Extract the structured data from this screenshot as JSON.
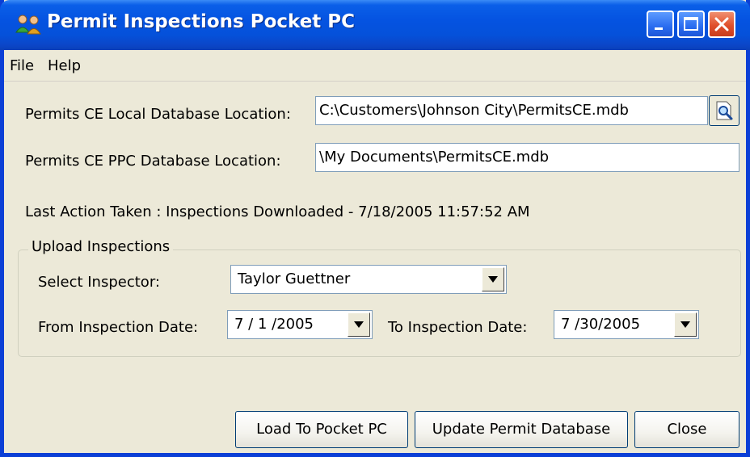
{
  "window": {
    "title": "Permit Inspections Pocket PC",
    "controls": {
      "minimize": "minimize-icon",
      "maximize": "maximize-icon",
      "close": "close-icon"
    }
  },
  "menu": {
    "items": [
      {
        "label": "File"
      },
      {
        "label": "Help"
      }
    ]
  },
  "local_db": {
    "label": "Permits CE Local Database Location:",
    "value": "C:\\Customers\\Johnson City\\PermitsCE.mdb",
    "browse_icon": "browse-search-icon"
  },
  "ppc_db": {
    "label": "Permits CE PPC Database Location:",
    "value": "\\My Documents\\PermitsCE.mdb"
  },
  "status": {
    "last_action": "Last Action Taken : Inspections Downloaded - 7/18/2005 11:57:52 AM"
  },
  "upload": {
    "group_label": "Upload Inspections",
    "inspector_label": "Select Inspector:",
    "inspector_value": "Taylor Guettner",
    "from_label": "From Inspection Date:",
    "from_value": "7 / 1 /2005",
    "to_label": "To Inspection Date:",
    "to_value": "7 /30/2005"
  },
  "buttons": {
    "load": "Load To Pocket PC",
    "update": "Update Permit Database",
    "close": "Close"
  },
  "colors": {
    "titlebar": "#0553e1",
    "window_bg": "#ece9d8",
    "close_button": "#e0502c"
  }
}
